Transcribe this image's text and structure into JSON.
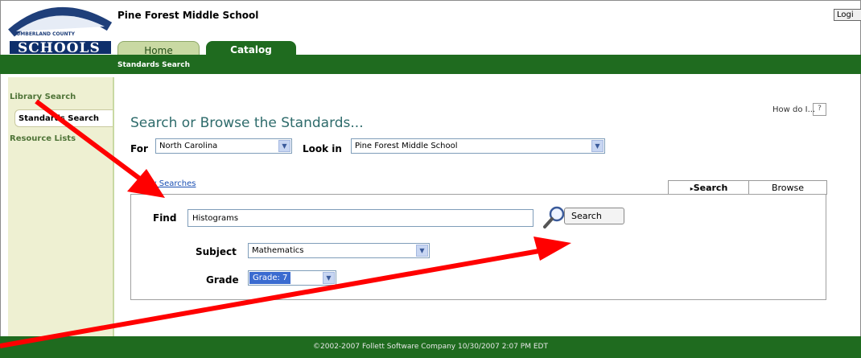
{
  "header": {
    "logo_text": "SCHOOLS",
    "logo_subtext": "CUMBERLAND COUNTY",
    "school_name": "Pine Forest Middle School",
    "login_label": "Logi"
  },
  "tabs": [
    {
      "label": "Home",
      "active": false
    },
    {
      "label": "Catalog",
      "active": true
    }
  ],
  "subnav": {
    "label": "Standards Search"
  },
  "sidebar": {
    "items": [
      {
        "label": "Library Search",
        "active": false
      },
      {
        "label": "Standards Search",
        "active": true
      },
      {
        "label": "Resource Lists",
        "active": false
      }
    ]
  },
  "main": {
    "help_text": "How do I...",
    "help_button": "?",
    "title": "Search or Browse the Standards...",
    "for_label": "For",
    "for_value": "North Carolina",
    "look_in_label": "Look in",
    "look_in_value": "Pine Forest Middle School",
    "my_searches_link": "My Searches",
    "mode_tabs": [
      {
        "label": "Search",
        "active": true
      },
      {
        "label": "Browse",
        "active": false
      }
    ],
    "find_label": "Find",
    "find_value": "Histograms",
    "search_button": "Search",
    "subject_label": "Subject",
    "subject_value": "Mathematics",
    "grade_label": "Grade",
    "grade_value": "Grade: 7"
  },
  "footer": {
    "text": "©2002-2007 Follett Software Company    10/30/2007 2:07 PM EDT"
  },
  "colors": {
    "brand_green": "#1f6b1f",
    "tab_light": "#c9d9a3",
    "annotation_red": "#ff0000"
  }
}
